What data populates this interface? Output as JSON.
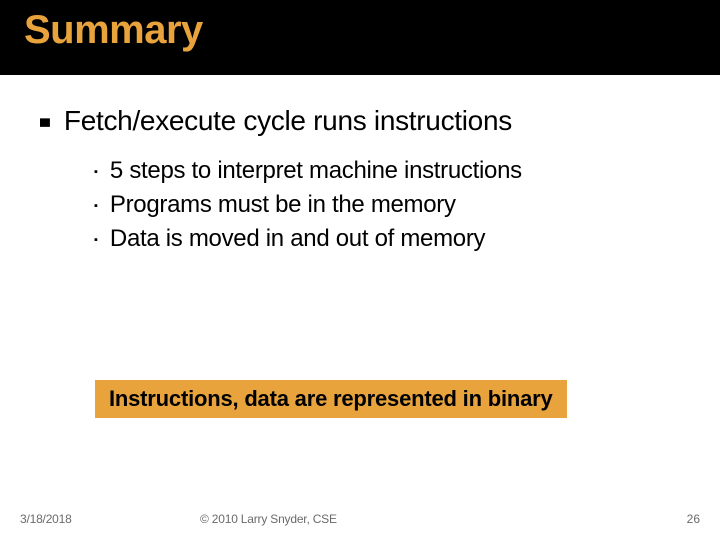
{
  "title": "Summary",
  "main_bullet": {
    "text": "Fetch/execute cycle runs instructions",
    "subs": [
      "5 steps to interpret machine instructions",
      "Programs must be in the memory",
      "Data is moved in and out of memory"
    ]
  },
  "callout": "Instructions, data are represented in binary",
  "footer": {
    "date": "3/18/2018",
    "copyright": "© 2010 Larry Snyder, CSE",
    "page": "26"
  },
  "colors": {
    "accent": "#e8a33d",
    "titlebar_bg": "#000000"
  }
}
